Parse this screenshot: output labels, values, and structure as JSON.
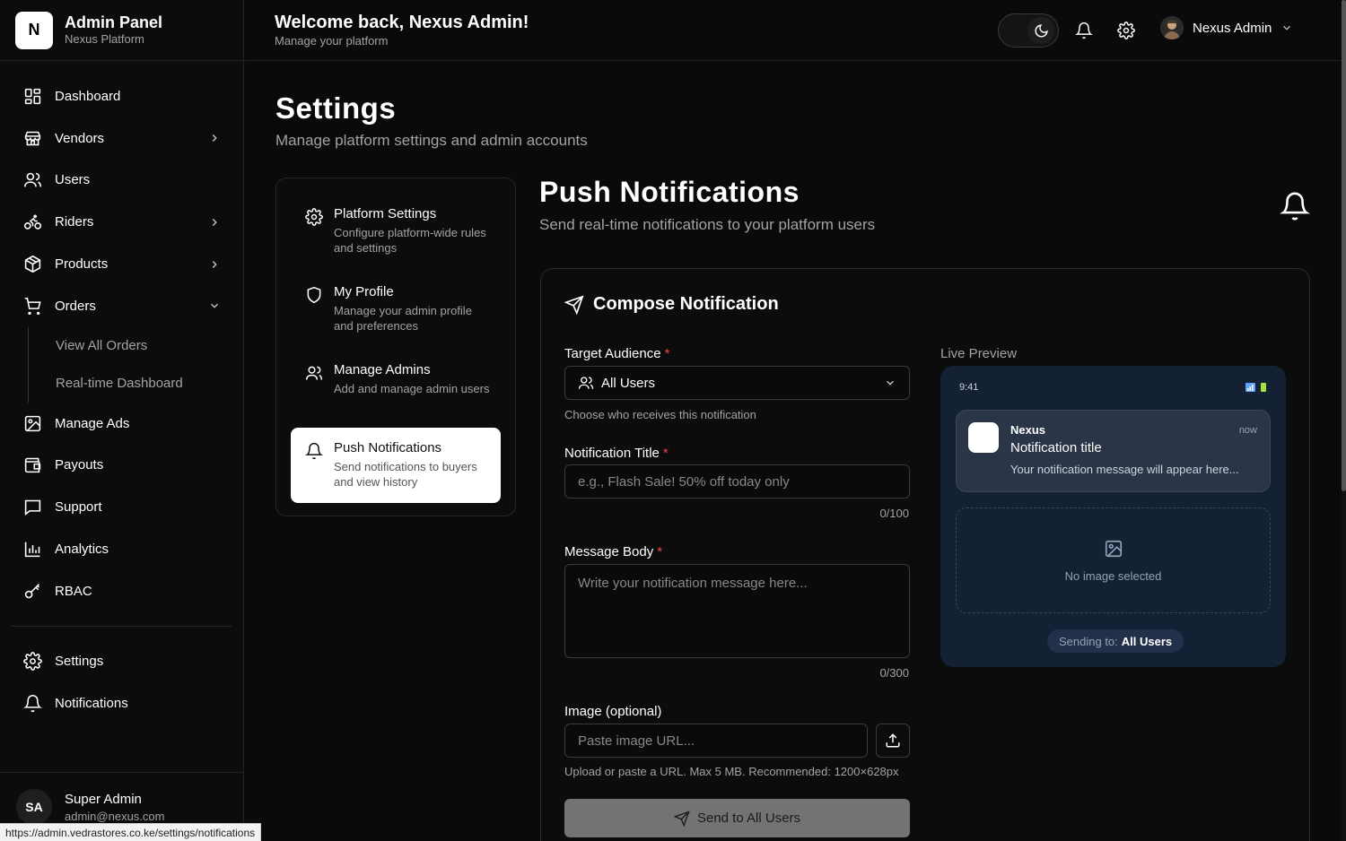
{
  "brand": {
    "logo_letter": "N",
    "title": "Admin Panel",
    "subtitle": "Nexus Platform"
  },
  "sidebar": {
    "items": [
      {
        "label": "Dashboard",
        "icon": "dashboard-icon"
      },
      {
        "label": "Vendors",
        "icon": "store-icon",
        "expandable": true
      },
      {
        "label": "Users",
        "icon": "users-icon"
      },
      {
        "label": "Riders",
        "icon": "bike-icon",
        "expandable": true
      },
      {
        "label": "Products",
        "icon": "package-icon",
        "expandable": true
      },
      {
        "label": "Orders",
        "icon": "cart-icon",
        "expanded": true
      },
      {
        "label": "Manage Ads",
        "icon": "image-icon"
      },
      {
        "label": "Payouts",
        "icon": "wallet-icon"
      },
      {
        "label": "Support",
        "icon": "message-icon"
      },
      {
        "label": "Analytics",
        "icon": "chart-icon"
      },
      {
        "label": "RBAC",
        "icon": "key-icon"
      }
    ],
    "orders_sub": [
      "View All Orders",
      "Real-time Dashboard"
    ],
    "bottom_items": [
      {
        "label": "Settings",
        "icon": "gear-icon"
      },
      {
        "label": "Notifications",
        "icon": "bell-icon"
      }
    ],
    "user": {
      "initials": "SA",
      "name": "Super Admin",
      "email": "admin@nexus.com"
    }
  },
  "status_url": "https://admin.vedrastores.co.ke/settings/notifications",
  "header": {
    "welcome": "Welcome back, Nexus Admin!",
    "subtitle": "Manage your platform",
    "profile_name": "Nexus Admin"
  },
  "page": {
    "title": "Settings",
    "subtitle": "Manage platform settings and admin accounts"
  },
  "settings_nav": [
    {
      "title": "Platform Settings",
      "desc": "Configure platform-wide rules and settings",
      "icon": "gear-icon"
    },
    {
      "title": "My Profile",
      "desc": "Manage your admin profile and preferences",
      "icon": "shield-icon"
    },
    {
      "title": "Manage Admins",
      "desc": "Add and manage admin users",
      "icon": "users-icon"
    },
    {
      "title": "Push Notifications",
      "desc": "Send notifications to buyers and view history",
      "icon": "bell-icon",
      "active": true
    }
  ],
  "push": {
    "title": "Push Notifications",
    "subtitle": "Send real-time notifications to your platform users"
  },
  "compose": {
    "heading": "Compose Notification",
    "audience_label": "Target Audience",
    "audience_value": "All Users",
    "audience_hint": "Choose who receives this notification",
    "title_label": "Notification Title",
    "title_placeholder": "e.g., Flash Sale! 50% off today only",
    "title_counter": "0/100",
    "body_label": "Message Body",
    "body_placeholder": "Write your notification message here...",
    "body_counter": "0/300",
    "image_label": "Image (optional)",
    "image_placeholder": "Paste image URL...",
    "image_hint": "Upload or paste a URL. Max 5 MB. Recommended: 1200×628px",
    "send_label": "Send to All Users",
    "required_mark": "*"
  },
  "preview": {
    "label": "Live Preview",
    "time": "9:41",
    "app": "Nexus",
    "when": "now",
    "notif_title": "Notification title",
    "notif_message": "Your notification message will appear here...",
    "no_image": "No image selected",
    "sending_prefix": "Sending to:",
    "sending_target": "All Users"
  }
}
